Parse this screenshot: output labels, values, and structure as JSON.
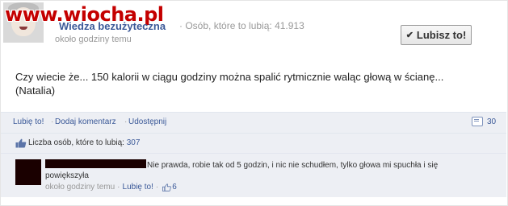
{
  "watermark": "www.wiocha.pl",
  "post": {
    "page_name": "Wiedza bezużyteczna",
    "likes_summary": "Osób, które to lubią: 41.913",
    "time": "około godziny temu",
    "like_page_button": "Lubisz to!",
    "text_line1": "Czy wiecie że... 150 kalorii w ciągu godziny można spalić rytmicznie waląc głową w ścianę...",
    "text_line2": "(Natalia)"
  },
  "actions": {
    "like": "Lubię to!",
    "comment": "Dodaj komentarz",
    "share": "Udostępnij",
    "separator": "·",
    "comment_count": "30"
  },
  "likes_bar": {
    "label": "Liczba osób, które to lubią:",
    "count": "307"
  },
  "comment": {
    "text_line1": "Nie prawda, robie tak od 5 godzin, i nic nie schudłem, tylko głowa mi spuchła i się",
    "text_line2": "powiększyła",
    "time": "około godziny temu",
    "separator": "·",
    "like": "Lubię to!",
    "like_count": "6"
  },
  "colors": {
    "link": "#3b5998",
    "muted": "#999999",
    "bar_bg": "#edeff4",
    "watermark": "#c40000"
  }
}
